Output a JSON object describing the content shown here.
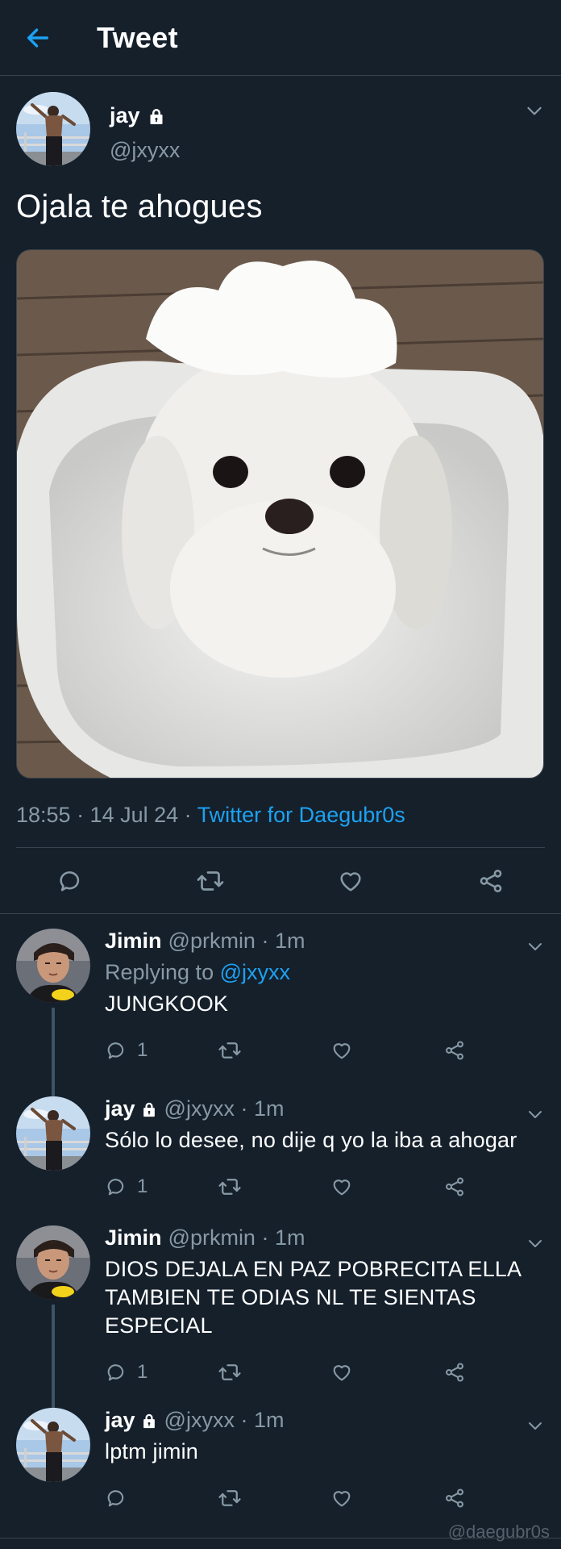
{
  "header": {
    "title": "Tweet"
  },
  "main_tweet": {
    "name": "jay",
    "handle": "@jxyxx",
    "text": "Ojala te ahogues",
    "time": "18:55 · 14 Jul 24 · ",
    "source": "Twitter for Daegubr0s"
  },
  "replies": [
    {
      "name": "Jimin",
      "meta": "@prkmin · 1m",
      "replying_label": "Replying to ",
      "replying_to": "@jxyxx",
      "text": "JUNGKOOK",
      "reply_count": "1"
    },
    {
      "name": "jay",
      "meta": "@jxyxx · 1m",
      "text": "Sólo lo desee, no dije q yo la iba a ahogar",
      "reply_count": "1"
    },
    {
      "name": "Jimin",
      "meta": "@prkmin · 1m",
      "text": "DIOS DEJALA EN PAZ POBRECITA ELLA TAMBIEN TE ODIAS NL TE SIENTAS ESPECIAL",
      "reply_count": "1"
    },
    {
      "name": "jay",
      "meta": "@jxyxx · 1m",
      "text": "lptm jimin",
      "reply_count": ""
    }
  ],
  "watermark": "@daegubr0s",
  "colors": {
    "background": "#15202b",
    "accent": "#1da1f2",
    "muted": "#8899a6",
    "divider": "#38444d"
  }
}
